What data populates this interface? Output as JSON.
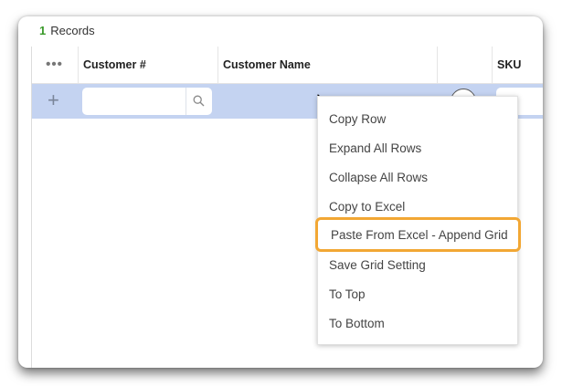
{
  "records": {
    "count": "1",
    "label": "Records"
  },
  "grid": {
    "headers": {
      "dots": "•••",
      "customer_number": "Customer #",
      "customer_name": "Customer Name",
      "sku": "SKU"
    },
    "add_row_symbol": "+"
  },
  "context_menu": {
    "items": [
      "Copy Row",
      "Expand All Rows",
      "Collapse All Rows",
      "Copy to Excel",
      "Paste From Excel - Append Grid",
      "Save Grid Setting",
      "To Top",
      "To Bottom"
    ],
    "highlighted_item": "Paste From Excel - Append Grid",
    "highlight_color": "#f2a734"
  },
  "colors": {
    "row_selected": "#c4d3f1",
    "records_count": "#3a9a2a"
  }
}
